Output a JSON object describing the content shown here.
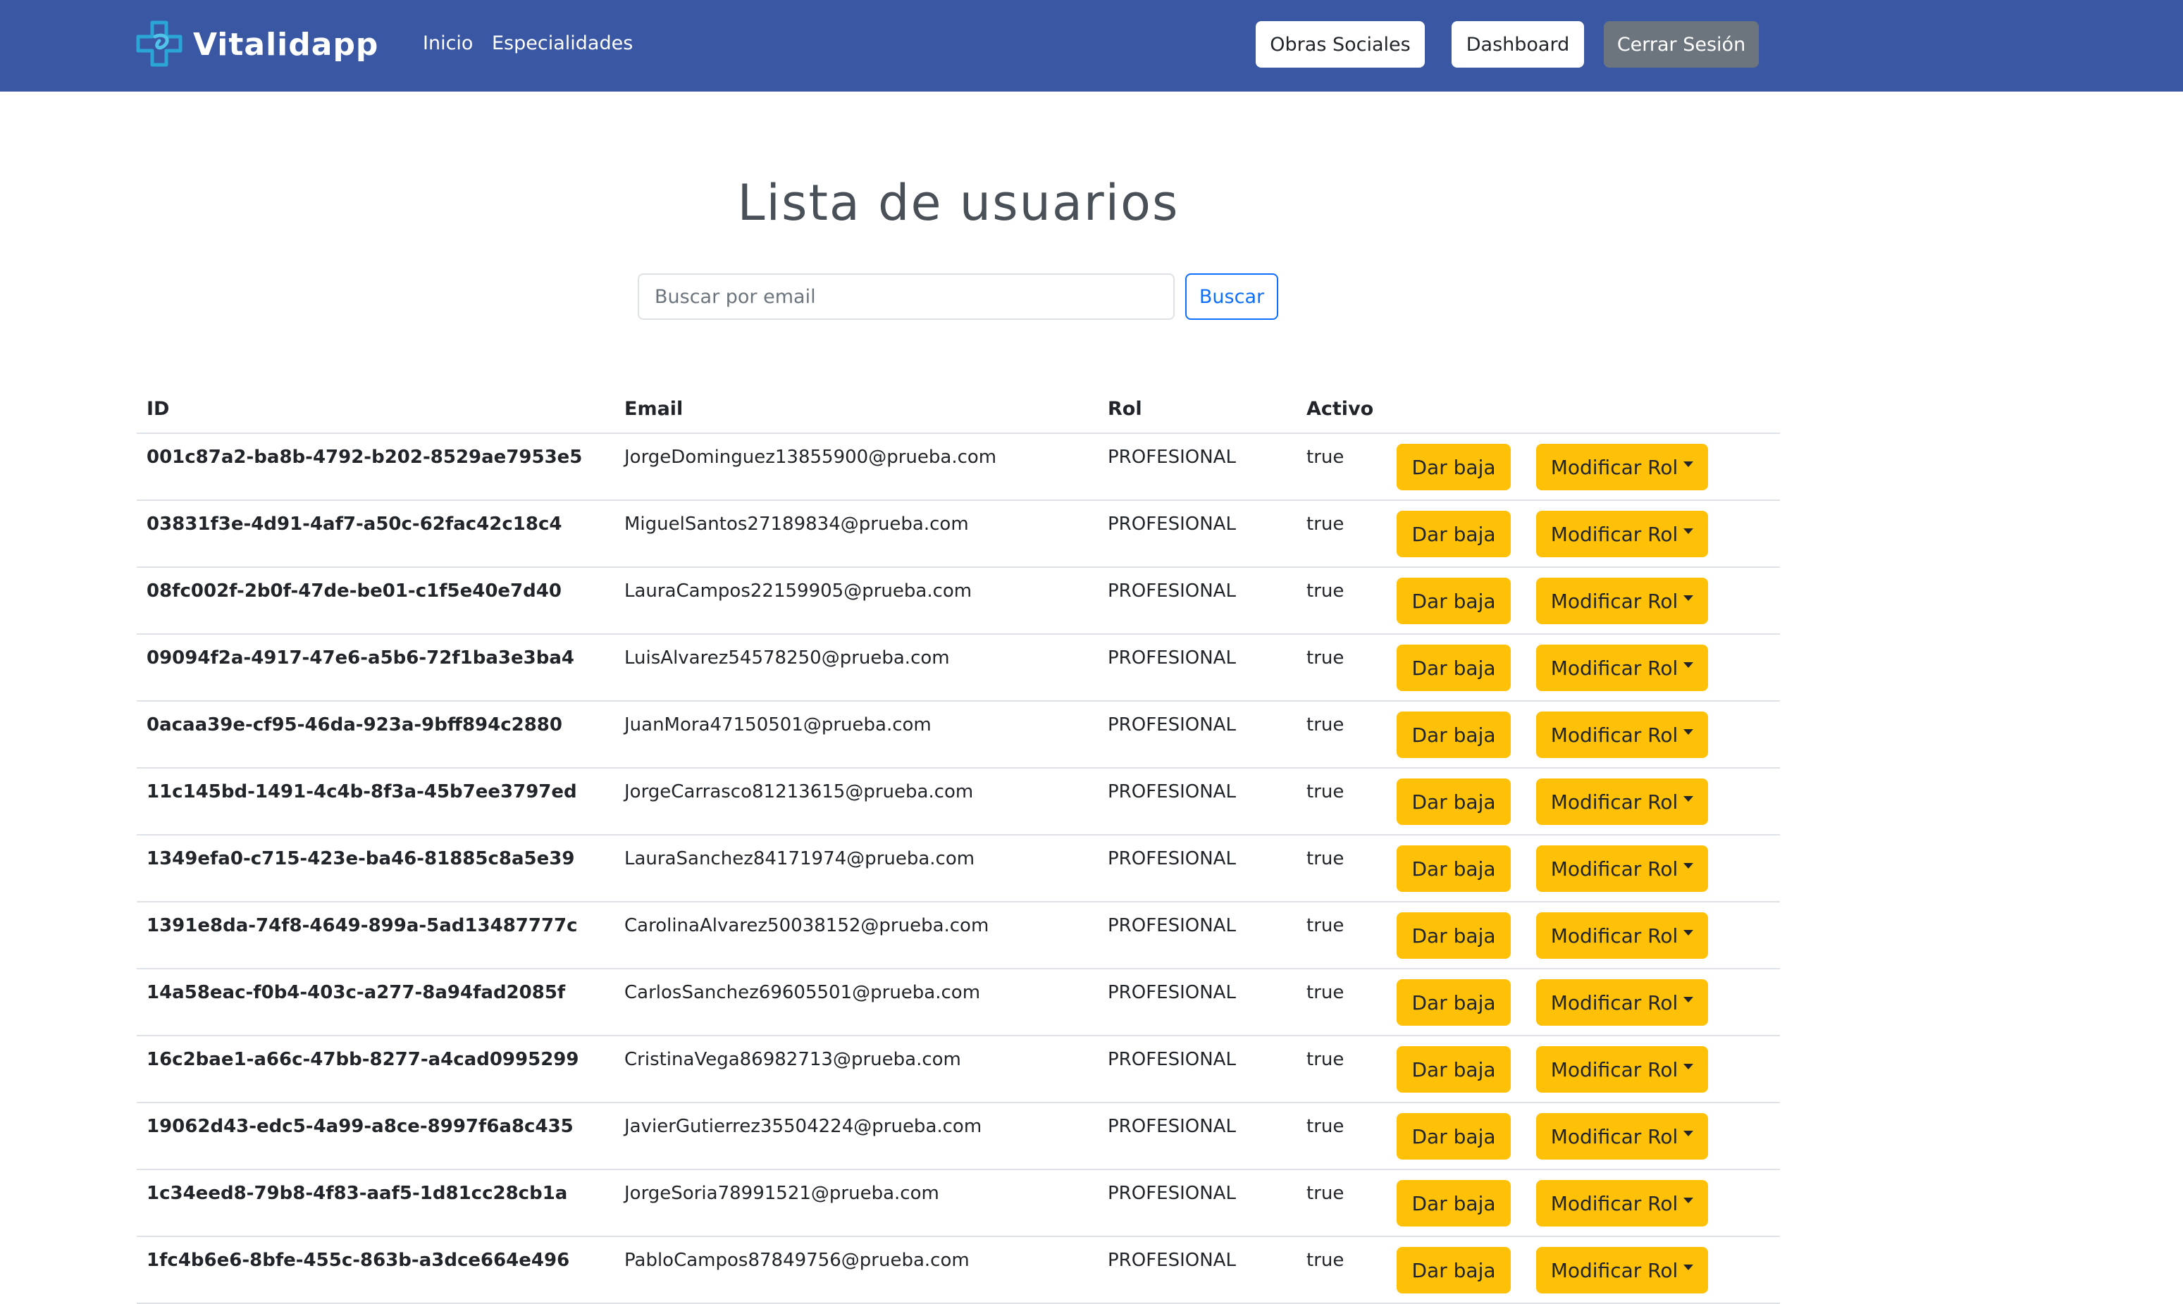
{
  "navbar": {
    "brand": "Vitalidapp",
    "links": [
      "Inicio",
      "Especialidades"
    ],
    "buttons": {
      "obras_sociales": "Obras Sociales",
      "dashboard": "Dashboard",
      "logout": "Cerrar Sesión"
    },
    "colors": {
      "background": "#3a57a4",
      "logo_primary": "#2aa6d6",
      "logo_secondary": "#4fc3e8"
    }
  },
  "page": {
    "title": "Lista de usuarios"
  },
  "search": {
    "placeholder": "Buscar por email",
    "button_label": "Buscar"
  },
  "table": {
    "headers": {
      "id": "ID",
      "email": "Email",
      "rol": "Rol",
      "activo": "Activo"
    },
    "action_labels": {
      "baja": "Dar baja",
      "modificar": "Modificar Rol"
    },
    "rows": [
      {
        "id": "001c87a2-ba8b-4792-b202-8529ae7953e5",
        "email": "JorgeDominguez13855900@prueba.com",
        "rol": "PROFESIONAL",
        "activo": "true"
      },
      {
        "id": "03831f3e-4d91-4af7-a50c-62fac42c18c4",
        "email": "MiguelSantos27189834@prueba.com",
        "rol": "PROFESIONAL",
        "activo": "true"
      },
      {
        "id": "08fc002f-2b0f-47de-be01-c1f5e40e7d40",
        "email": "LauraCampos22159905@prueba.com",
        "rol": "PROFESIONAL",
        "activo": "true"
      },
      {
        "id": "09094f2a-4917-47e6-a5b6-72f1ba3e3ba4",
        "email": "LuisAlvarez54578250@prueba.com",
        "rol": "PROFESIONAL",
        "activo": "true"
      },
      {
        "id": "0acaa39e-cf95-46da-923a-9bff894c2880",
        "email": "JuanMora47150501@prueba.com",
        "rol": "PROFESIONAL",
        "activo": "true"
      },
      {
        "id": "11c145bd-1491-4c4b-8f3a-45b7ee3797ed",
        "email": "JorgeCarrasco81213615@prueba.com",
        "rol": "PROFESIONAL",
        "activo": "true"
      },
      {
        "id": "1349efa0-c715-423e-ba46-81885c8a5e39",
        "email": "LauraSanchez84171974@prueba.com",
        "rol": "PROFESIONAL",
        "activo": "true"
      },
      {
        "id": "1391e8da-74f8-4649-899a-5ad13487777c",
        "email": "CarolinaAlvarez50038152@prueba.com",
        "rol": "PROFESIONAL",
        "activo": "true"
      },
      {
        "id": "14a58eac-f0b4-403c-a277-8a94fad2085f",
        "email": "CarlosSanchez69605501@prueba.com",
        "rol": "PROFESIONAL",
        "activo": "true"
      },
      {
        "id": "16c2bae1-a66c-47bb-8277-a4cad0995299",
        "email": "CristinaVega86982713@prueba.com",
        "rol": "PROFESIONAL",
        "activo": "true"
      },
      {
        "id": "19062d43-edc5-4a99-a8ce-8997f6a8c435",
        "email": "JavierGutierrez35504224@prueba.com",
        "rol": "PROFESIONAL",
        "activo": "true"
      },
      {
        "id": "1c34eed8-79b8-4f83-aaf5-1d81cc28cb1a",
        "email": "JorgeSoria78991521@prueba.com",
        "rol": "PROFESIONAL",
        "activo": "true"
      },
      {
        "id": "1fc4b6e6-8bfe-455c-863b-a3dce664e496",
        "email": "PabloCampos87849756@prueba.com",
        "rol": "PROFESIONAL",
        "activo": "true"
      }
    ]
  }
}
